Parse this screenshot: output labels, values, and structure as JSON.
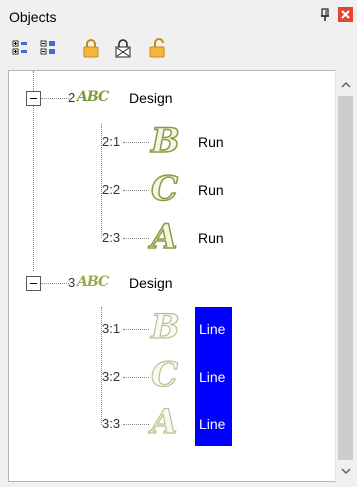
{
  "panel": {
    "title": "Objects",
    "icons": {
      "pin": "pin-icon",
      "close": "close-icon"
    }
  },
  "toolbar": {
    "buttons": [
      {
        "icon": "expand-all-icon"
      },
      {
        "icon": "collapse-all-icon"
      },
      {
        "icon": "lock-icon"
      },
      {
        "icon": "lock-x-icon"
      },
      {
        "icon": "unlock-icon"
      }
    ]
  },
  "tree": {
    "groups": [
      {
        "number": "2",
        "logo_text": "ABC",
        "label": "Design",
        "items": [
          {
            "number": "2:1",
            "glyph": "B",
            "label": "Run"
          },
          {
            "number": "2:2",
            "glyph": "C",
            "label": "Run"
          },
          {
            "number": "2:3",
            "glyph": "A",
            "label": "Run"
          }
        ]
      },
      {
        "number": "3",
        "logo_text": "ABC",
        "label": "Design",
        "items": [
          {
            "number": "3:1",
            "glyph": "B",
            "label": "Line"
          },
          {
            "number": "3:2",
            "glyph": "C",
            "label": "Line"
          },
          {
            "number": "3:3",
            "glyph": "A",
            "label": "Line"
          }
        ]
      }
    ]
  },
  "colors": {
    "selection": "#0000ff",
    "embroidery_outline": "#8a9a40",
    "close_button": "#e8432b"
  }
}
